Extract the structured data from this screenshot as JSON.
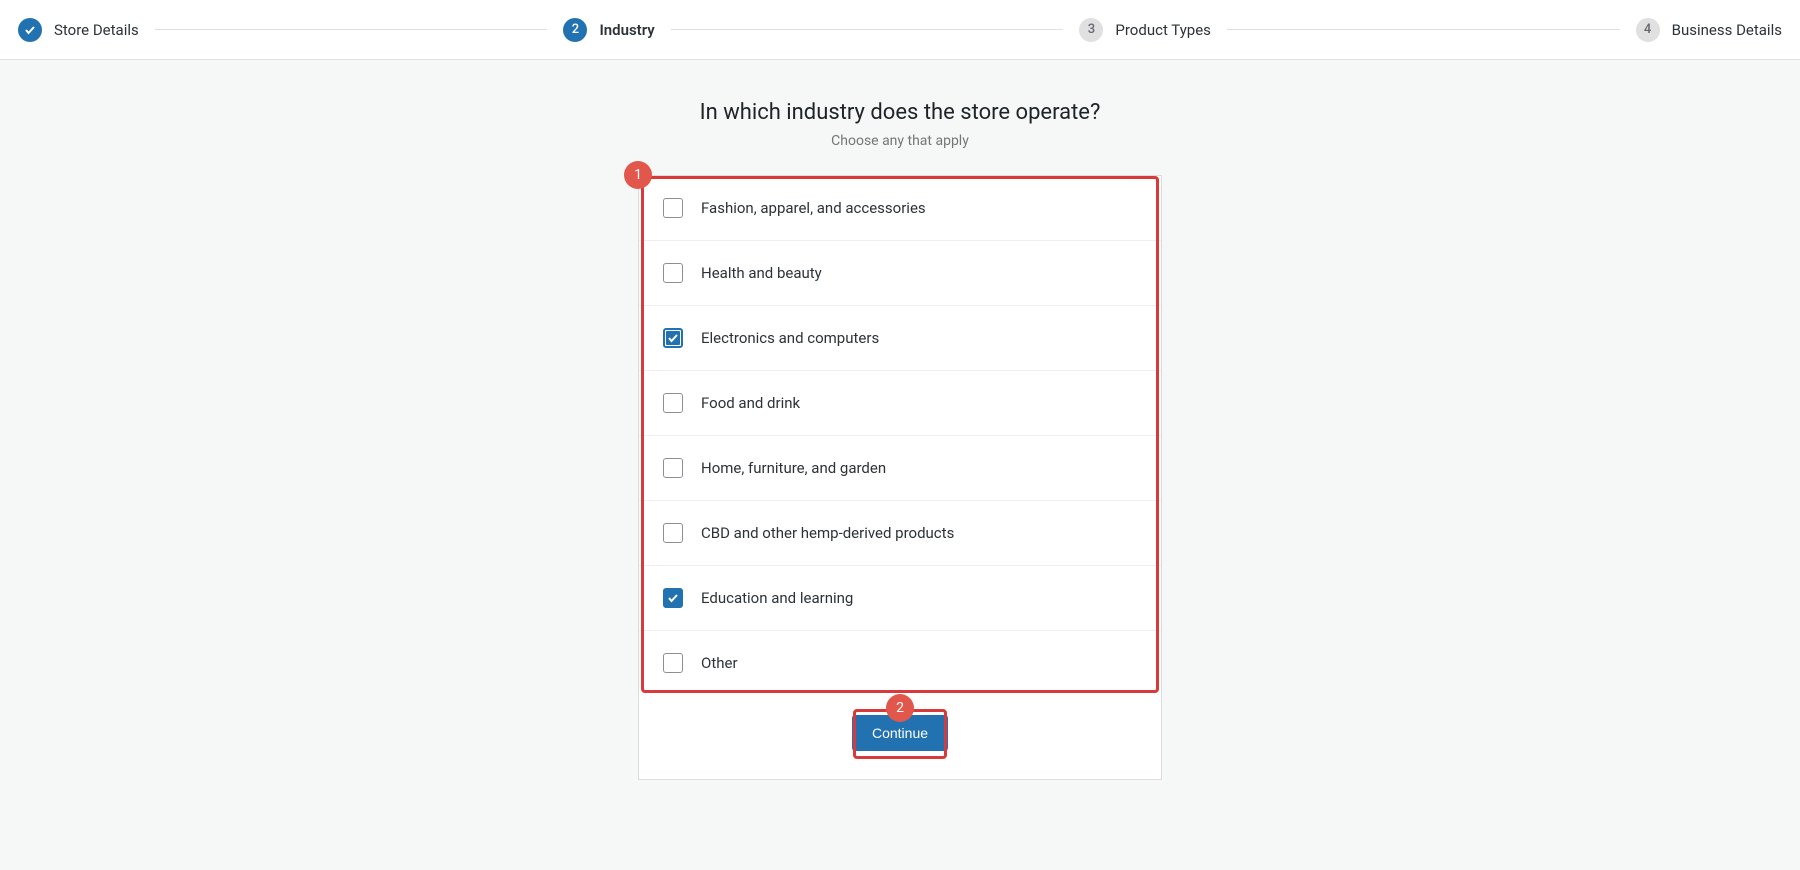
{
  "stepper": {
    "steps": [
      {
        "label": "Store Details",
        "state": "done",
        "indicator": "✓"
      },
      {
        "label": "Industry",
        "state": "active",
        "indicator": "2"
      },
      {
        "label": "Product Types",
        "state": "pending",
        "indicator": "3"
      },
      {
        "label": "Business Details",
        "state": "pending",
        "indicator": "4"
      }
    ]
  },
  "heading": "In which industry does the store operate?",
  "subheading": "Choose any that apply",
  "options": [
    {
      "label": "Fashion, apparel, and accessories",
      "checked": false,
      "focused": false
    },
    {
      "label": "Health and beauty",
      "checked": false,
      "focused": false
    },
    {
      "label": "Electronics and computers",
      "checked": true,
      "focused": true
    },
    {
      "label": "Food and drink",
      "checked": false,
      "focused": false
    },
    {
      "label": "Home, furniture, and garden",
      "checked": false,
      "focused": false
    },
    {
      "label": "CBD and other hemp-derived products",
      "checked": false,
      "focused": false
    },
    {
      "label": "Education and learning",
      "checked": true,
      "focused": false
    },
    {
      "label": "Other",
      "checked": false,
      "focused": false
    }
  ],
  "continue_label": "Continue",
  "annotations": {
    "badge1": "1",
    "badge2": "2"
  }
}
